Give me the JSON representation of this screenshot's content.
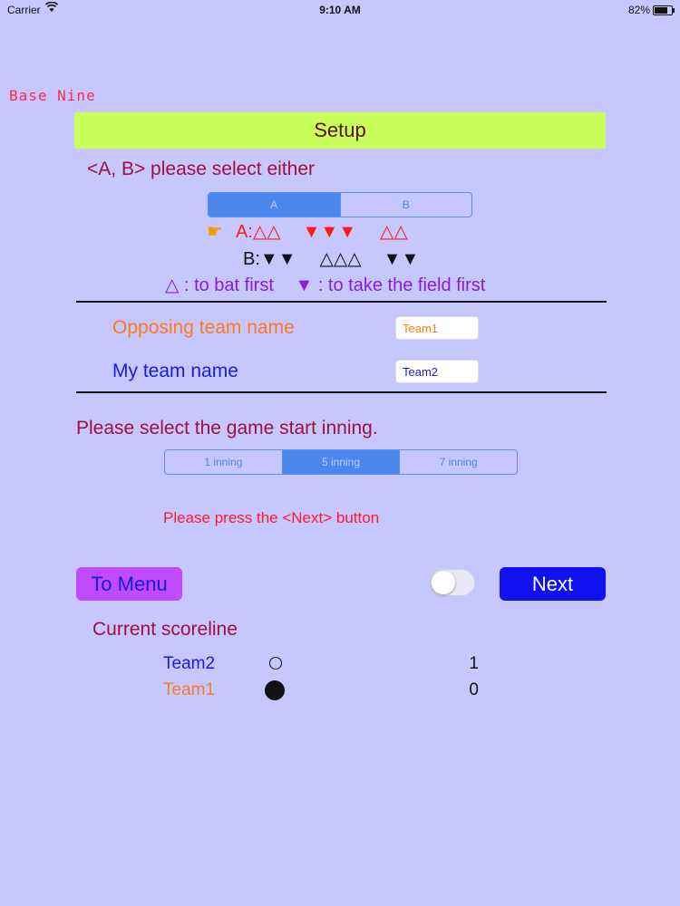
{
  "status": {
    "carrier": "Carrier",
    "time": "9:10 AM",
    "battery": "82%"
  },
  "app": {
    "logo": "Base Nine"
  },
  "header": {
    "title": "Setup"
  },
  "select_ab": {
    "prompt": "<A, B> please select either",
    "options": [
      "A",
      "B"
    ],
    "selected": "A",
    "row_a": {
      "label": "A:",
      "g1": "△△",
      "g2": "▼▼▼",
      "g3": "△△"
    },
    "row_b": {
      "label": "B:",
      "g1": "▼▼",
      "g2": "△△△",
      "g3": "▼▼"
    },
    "legend_bat_symbol": "△",
    "legend_bat": ": to bat first",
    "legend_field_symbol": "▼",
    "legend_field": ": to take the field first"
  },
  "teams": {
    "opposing_label": "Opposing team name",
    "opposing_value": "Team1",
    "my_label": "My team name",
    "my_value": "Team2"
  },
  "inning": {
    "prompt": "Please select the game start inning.",
    "options": [
      "1 inning",
      "5 inning",
      "7 inning"
    ],
    "selected": "5 inning"
  },
  "hint": "Please press the <Next> button",
  "actions": {
    "menu": "To Menu",
    "next": "Next",
    "toggle_on": false
  },
  "scoreline": {
    "title": "Current scoreline",
    "rows": [
      {
        "team": "Team2",
        "score": "1"
      },
      {
        "team": "Team1",
        "score": "0"
      }
    ]
  },
  "colors": {
    "background": "#c7c7ff",
    "header": "#c8ff5a",
    "segment": "#4a88f0",
    "next_button": "#1010f0",
    "menu_button": "#c04aff"
  }
}
